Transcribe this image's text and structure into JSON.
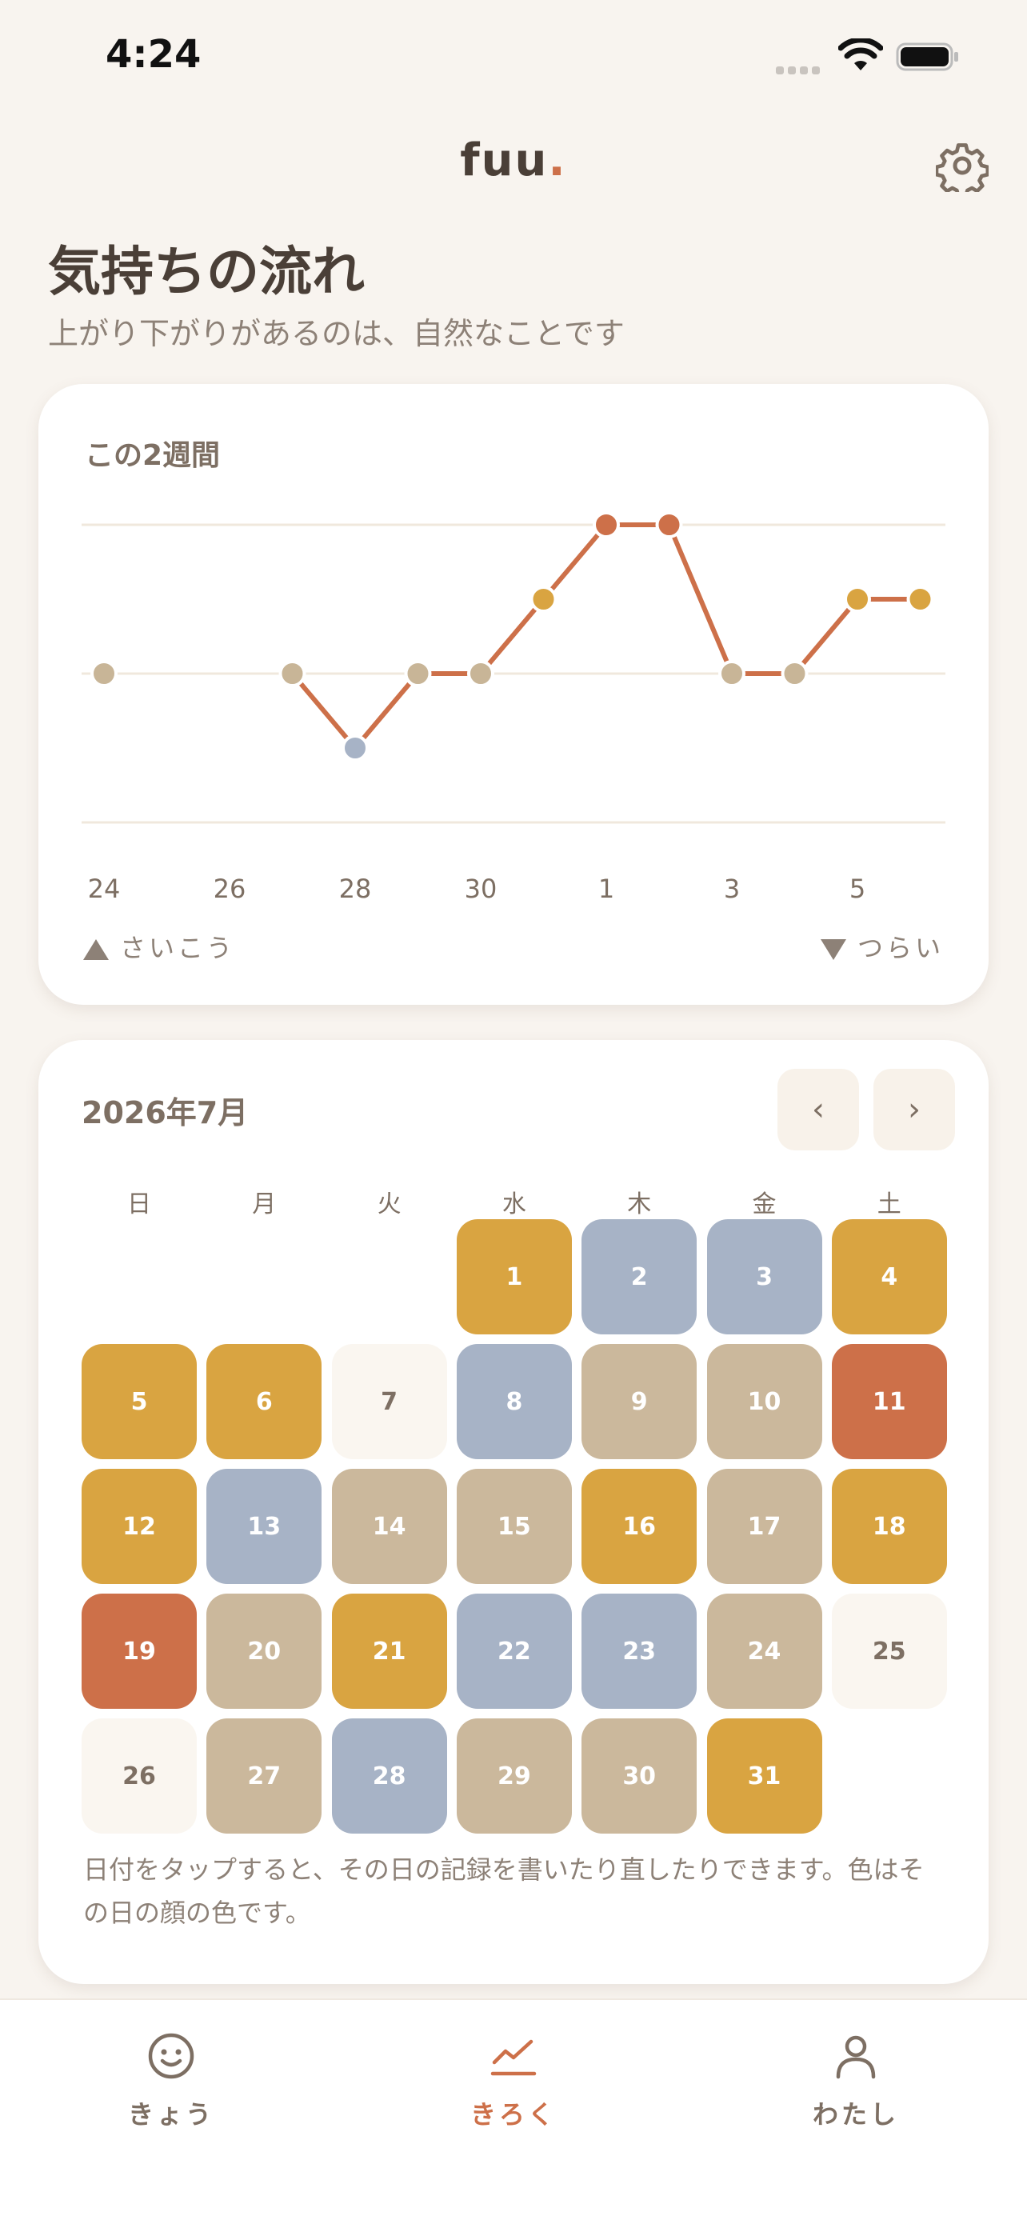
{
  "status_bar": {
    "time": "4:24"
  },
  "header": {
    "logo": "fuu",
    "logo_dot": "."
  },
  "page": {
    "title": "気持ちの流れ",
    "subtitle": "上がり下がりがあるのは、自然なことです"
  },
  "trend_card": {
    "title": "この2週間",
    "legend_best": "さいこう",
    "legend_worst": "つらい"
  },
  "chart_data": {
    "type": "line",
    "title": "この2週間",
    "x_ticks": [
      "24",
      "26",
      "28",
      "30",
      "1",
      "3",
      "5"
    ],
    "levels": 3,
    "points": [
      {
        "date": "6/24",
        "value": 0,
        "color": "#c8b597"
      },
      {
        "date": "6/27",
        "value": 0,
        "color": "#c8b597"
      },
      {
        "date": "6/28",
        "value": -1,
        "color": "#a7b3c6"
      },
      {
        "date": "6/29",
        "value": 0,
        "color": "#c8b597"
      },
      {
        "date": "6/30",
        "value": 0,
        "color": "#c8b597"
      },
      {
        "date": "7/1",
        "value": 1,
        "color": "#d9a441"
      },
      {
        "date": "7/2",
        "value": 2,
        "color": "#cd7049"
      },
      {
        "date": "7/3",
        "value": 2,
        "color": "#cd7049"
      },
      {
        "date": "7/4",
        "value": 0,
        "color": "#c8b597"
      },
      {
        "date": "7/5",
        "value": 0,
        "color": "#c8b597"
      },
      {
        "date": "7/6",
        "value": 1,
        "color": "#d9a441"
      },
      {
        "date": "7/7",
        "value": 1,
        "color": "#d9a441"
      }
    ],
    "line_color": "#cd7049",
    "grid": true
  },
  "calendar": {
    "month_label": "2026年7月",
    "prev_label": "‹",
    "next_label": "›",
    "weekdays": [
      "日",
      "月",
      "火",
      "水",
      "木",
      "金",
      "土"
    ],
    "first_weekday": 3,
    "days": [
      {
        "n": "1",
        "color": "#d9a441"
      },
      {
        "n": "2",
        "color": "#a7b3c6"
      },
      {
        "n": "3",
        "color": "#a7b3c6"
      },
      {
        "n": "4",
        "color": "#d9a441"
      },
      {
        "n": "5",
        "color": "#d9a441"
      },
      {
        "n": "6",
        "color": "#d9a441"
      },
      {
        "n": "7",
        "color": "#faf6f0",
        "text": "#7d6f63"
      },
      {
        "n": "8",
        "color": "#a7b3c6"
      },
      {
        "n": "9",
        "color": "#cbb89c"
      },
      {
        "n": "10",
        "color": "#cbb89c"
      },
      {
        "n": "11",
        "color": "#cd7049"
      },
      {
        "n": "12",
        "color": "#d9a441"
      },
      {
        "n": "13",
        "color": "#a7b3c6"
      },
      {
        "n": "14",
        "color": "#cbb89c"
      },
      {
        "n": "15",
        "color": "#cbb89c"
      },
      {
        "n": "16",
        "color": "#d9a441"
      },
      {
        "n": "17",
        "color": "#cbb89c"
      },
      {
        "n": "18",
        "color": "#d9a441"
      },
      {
        "n": "19",
        "color": "#cd7049"
      },
      {
        "n": "20",
        "color": "#cbb89c"
      },
      {
        "n": "21",
        "color": "#d9a441"
      },
      {
        "n": "22",
        "color": "#a7b3c6"
      },
      {
        "n": "23",
        "color": "#a7b3c6"
      },
      {
        "n": "24",
        "color": "#cbb89c"
      },
      {
        "n": "25",
        "color": "#faf6f0",
        "text": "#7d6f63"
      },
      {
        "n": "26",
        "color": "#faf6f0",
        "text": "#7d6f63"
      },
      {
        "n": "27",
        "color": "#cbb89c"
      },
      {
        "n": "28",
        "color": "#a7b3c6"
      },
      {
        "n": "29",
        "color": "#cbb89c"
      },
      {
        "n": "30",
        "color": "#cbb89c"
      },
      {
        "n": "31",
        "color": "#d9a441"
      }
    ],
    "note": "日付をタップすると、その日の記録を書いたり直したりできます。色はその日の顔の色です。"
  },
  "bottom_nav": {
    "today": "きょう",
    "record": "きろく",
    "me": "わたし",
    "active": "record"
  },
  "colors": {
    "accent": "#cd7049",
    "background": "#f8f4ef",
    "text": "#4a3f37"
  }
}
